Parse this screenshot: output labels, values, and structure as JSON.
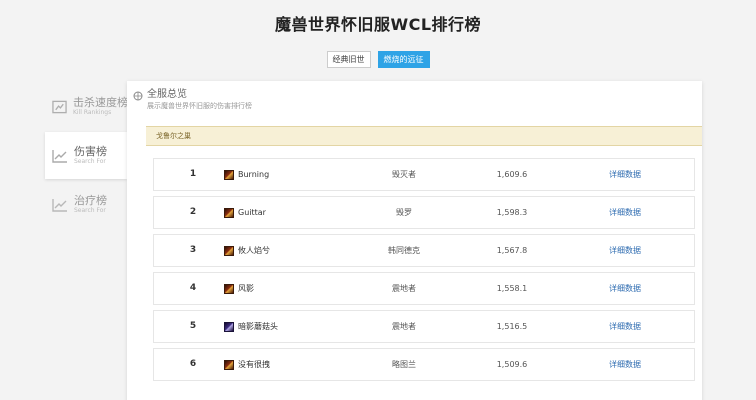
{
  "page": {
    "title": "魔兽世界怀旧服WCL排行榜"
  },
  "version_tabs": [
    {
      "label": "经典旧世",
      "active": false
    },
    {
      "label": "燃烧的远征",
      "active": true
    }
  ],
  "sidebar": {
    "items": [
      {
        "title": "击杀速度榜",
        "subtitle": "Kill Rankings",
        "icon": "chart-icon",
        "active": false
      },
      {
        "title": "伤害榜",
        "subtitle": "Search For",
        "icon": "chart-icon",
        "active": true
      },
      {
        "title": "治疗榜",
        "subtitle": "Search For",
        "icon": "chart-icon",
        "active": false
      }
    ]
  },
  "panel": {
    "title": "全服总览",
    "description": "展示魔兽世界怀旧服的伤害排行榜",
    "realm": "戈鲁尔之巢"
  },
  "rankings": [
    {
      "rank": "1",
      "name": "Burning",
      "spec": "毁灭者",
      "score": "1,609.6",
      "link": "详细数据",
      "icon": "warrior-class-icon"
    },
    {
      "rank": "2",
      "name": "Guittar",
      "spec": "毁罗",
      "score": "1,598.3",
      "link": "详细数据",
      "icon": "warrior-class-icon"
    },
    {
      "rank": "3",
      "name": "攸人焰兮",
      "spec": "韩同德克",
      "score": "1,567.8",
      "link": "详细数据",
      "icon": "warrior-class-icon"
    },
    {
      "rank": "4",
      "name": "风影",
      "spec": "震地者",
      "score": "1,558.1",
      "link": "详细数据",
      "icon": "warrior-class-icon"
    },
    {
      "rank": "5",
      "name": "暗影蘑菇头",
      "spec": "震地者",
      "score": "1,516.5",
      "link": "详细数据",
      "icon": "shadow-class-icon"
    },
    {
      "rank": "6",
      "name": "没有很拽",
      "spec": "略图兰",
      "score": "1,509.6",
      "link": "详细数据",
      "icon": "warrior-class-icon"
    }
  ],
  "colors": {
    "accent": "#2ea3e6",
    "realm_bar": "#f7f0d6",
    "link": "#2d6bb0"
  }
}
